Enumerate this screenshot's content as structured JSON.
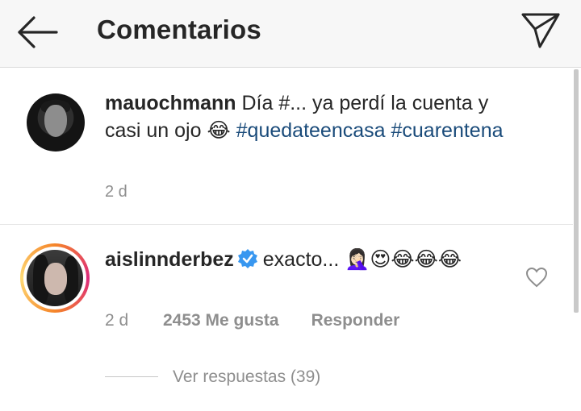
{
  "header": {
    "title": "Comentarios",
    "back_icon": "arrow-left-icon",
    "share_icon": "paper-plane-icon"
  },
  "caption": {
    "username": "mauochmann",
    "text_part1": "Día #... ya perdí la cuenta y casi un ojo",
    "emoji": "😂",
    "hashtag1": "#quedateencasa",
    "hashtag2": "#cuarentena",
    "time": "2 d"
  },
  "comment": {
    "username": "aislinnderbez",
    "text": "exacto...",
    "emojis": "🤦🏻‍♀️😍😂😂😂",
    "time": "2 d",
    "likes": "2453 Me gusta",
    "reply": "Responder",
    "view_replies": "Ver respuestas (39)"
  },
  "colors": {
    "hashtag": "#1a4b7a",
    "verified": "#3897f0",
    "secondary_text": "#8e8e8e"
  }
}
